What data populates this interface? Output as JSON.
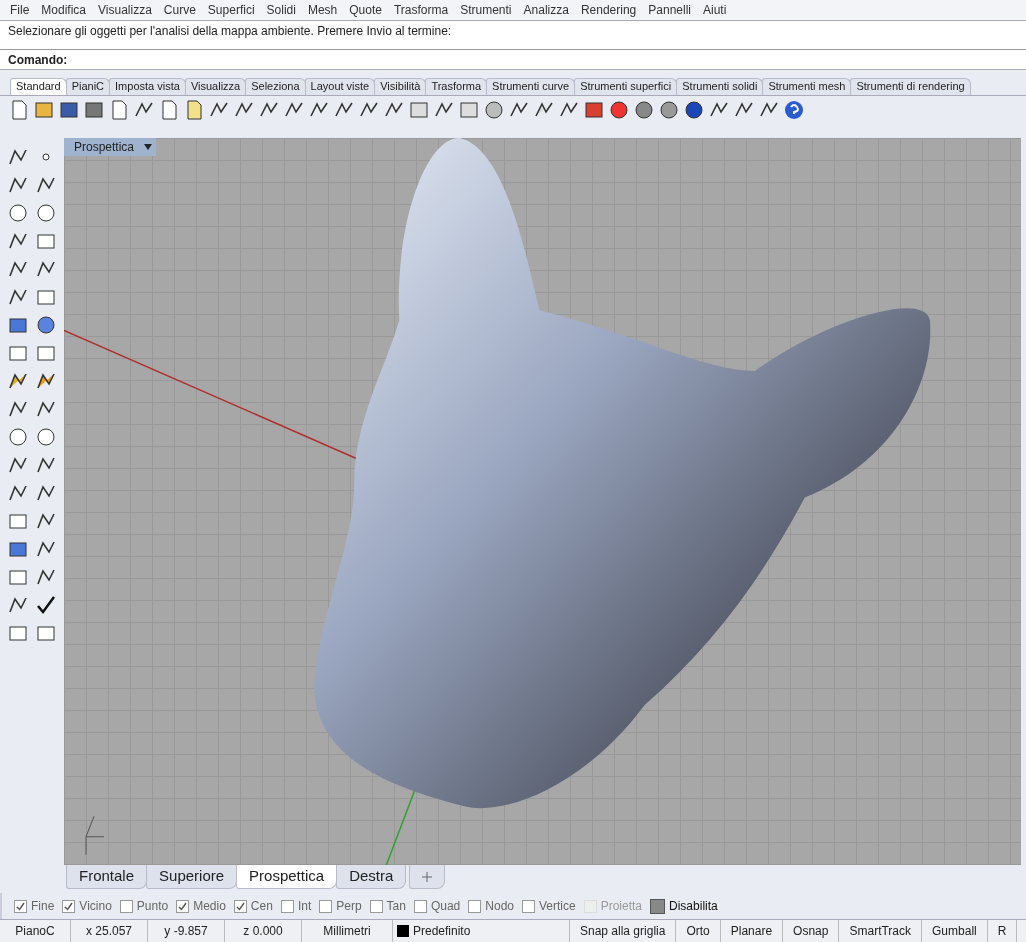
{
  "menu_bar": {
    "items": [
      "File",
      "Modifica",
      "Visualizza",
      "Curve",
      "Superfici",
      "Solidi",
      "Mesh",
      "Quote",
      "Trasforma",
      "Strumenti",
      "Analizza",
      "Rendering",
      "Pannelli",
      "Aiuti"
    ]
  },
  "command_area": {
    "history": "Selezionare gli oggetti per l'analisi della mappa ambiente. Premere Invio al termine:",
    "prompt_label": "Comando:"
  },
  "toolbar_tabs": [
    {
      "label": "Standard",
      "selected": true
    },
    {
      "label": "PianiC",
      "selected": false
    },
    {
      "label": "Imposta vista",
      "selected": false
    },
    {
      "label": "Visualizza",
      "selected": false
    },
    {
      "label": "Seleziona",
      "selected": false
    },
    {
      "label": "Layout viste",
      "selected": false
    },
    {
      "label": "Visibilità",
      "selected": false
    },
    {
      "label": "Trasforma",
      "selected": false
    },
    {
      "label": "Strumenti curve",
      "selected": false
    },
    {
      "label": "Strumenti superfici",
      "selected": false
    },
    {
      "label": "Strumenti solidi",
      "selected": false
    },
    {
      "label": "Strumenti mesh",
      "selected": false
    },
    {
      "label": "Strumenti di rendering",
      "selected": false
    }
  ],
  "viewport": {
    "title": "Prospettica"
  },
  "viewport_tabs": [
    {
      "label": "Frontale",
      "selected": false
    },
    {
      "label": "Superiore",
      "selected": false
    },
    {
      "label": "Prospettica",
      "selected": true
    },
    {
      "label": "Destra",
      "selected": false
    }
  ],
  "osnap": [
    {
      "label": "Fine",
      "checked": true,
      "disabled": false
    },
    {
      "label": "Vicino",
      "checked": true,
      "disabled": false
    },
    {
      "label": "Punto",
      "checked": false,
      "disabled": false
    },
    {
      "label": "Medio",
      "checked": true,
      "disabled": false
    },
    {
      "label": "Cen",
      "checked": true,
      "disabled": false
    },
    {
      "label": "Int",
      "checked": false,
      "disabled": false
    },
    {
      "label": "Perp",
      "checked": false,
      "disabled": false
    },
    {
      "label": "Tan",
      "checked": false,
      "disabled": false
    },
    {
      "label": "Quad",
      "checked": false,
      "disabled": false
    },
    {
      "label": "Nodo",
      "checked": false,
      "disabled": false
    },
    {
      "label": "Vertice",
      "checked": false,
      "disabled": false
    },
    {
      "label": "Proietta",
      "checked": false,
      "disabled": true
    },
    {
      "label": "Disabilita",
      "checked": true,
      "disabled": false,
      "kind": "toggle"
    }
  ],
  "status_bar": {
    "cplane": "PianoC",
    "x": "x 25.057",
    "y": "y -9.857",
    "z": "z 0.000",
    "units": "Millimetri",
    "layer": {
      "label": "Predefinito",
      "color": "#000000"
    },
    "toggles": [
      "Snap alla griglia",
      "Orto",
      "Planare",
      "Osnap",
      "SmartTrack",
      "Gumball",
      "R"
    ]
  }
}
